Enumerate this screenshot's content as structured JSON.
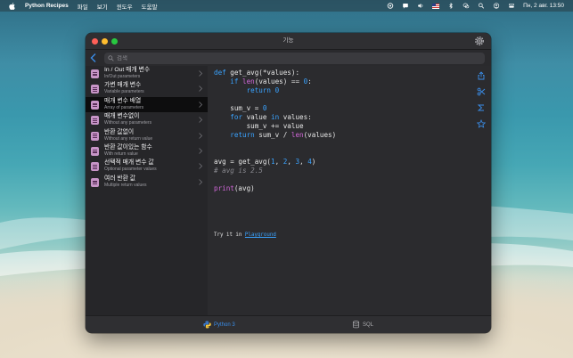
{
  "menubar": {
    "app_name": "Python Recipes",
    "menus": [
      "파일",
      "보기",
      "윈도우",
      "도움말"
    ],
    "clock": "Пн, 2 авг.  13:50"
  },
  "window": {
    "title": "기능",
    "search_placeholder": "검색"
  },
  "sidebar": {
    "items": [
      {
        "title": "In / Out 매개 변수",
        "subtitle": "In/Out parameters"
      },
      {
        "title": "가변 매개 변수",
        "subtitle": "Variable parameters"
      },
      {
        "title": "매개 변수 배열",
        "subtitle": "Array of parameters",
        "selected": true
      },
      {
        "title": "매개 변수없이",
        "subtitle": "Without any parameters"
      },
      {
        "title": "반환 값없이",
        "subtitle": "Without any return value"
      },
      {
        "title": "반환 값이있는 함수",
        "subtitle": "With return value"
      },
      {
        "title": "선택적 매개 변수 값",
        "subtitle": "Optional parameter values"
      },
      {
        "title": "여러 반환 값",
        "subtitle": "Multiple return values"
      }
    ]
  },
  "code": {
    "try_it_prefix": "Try it in",
    "try_it_link": "Playground"
  },
  "tabs": {
    "python": "Python 3",
    "sql": "SQL"
  },
  "colors": {
    "accent": "#3a8eea",
    "keyword": "#3aa3ff",
    "builtin": "#d067d8",
    "selected_row": "#0d0d0e"
  }
}
